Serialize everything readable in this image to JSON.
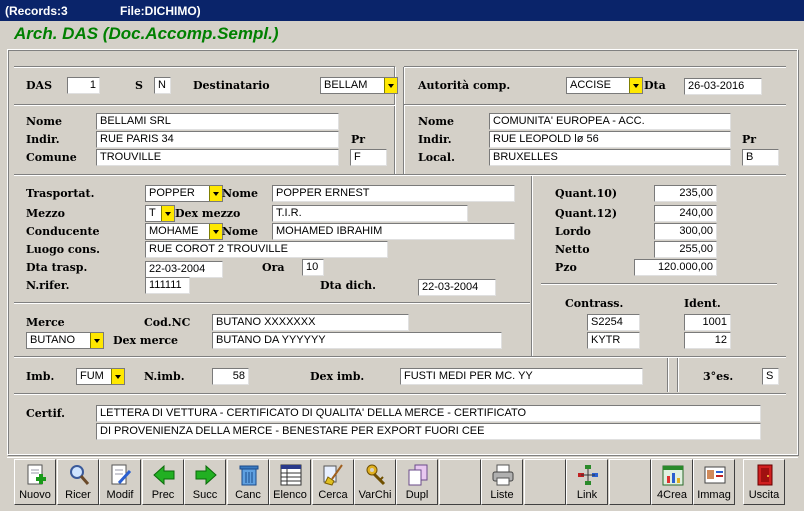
{
  "titlebar": {
    "records": "(Records:3",
    "file": "File:DICHIMO)"
  },
  "app_title": "Arch. DAS (Doc.Accomp.Sempl.)",
  "header": {
    "das_label": "DAS",
    "das_value": "1",
    "s_label": "S",
    "s_value": "N",
    "destinatario_label": "Destinatario",
    "destinatario_value": "BELLAM",
    "autorita_label": "Autorità comp.",
    "autorita_value": "ACCISE",
    "dta_label": "Dta",
    "dta_value": "26-03-2016"
  },
  "dest": {
    "nome_label": "Nome",
    "nome_value": "BELLAMI SRL",
    "indir_label": "Indir.",
    "indir_value": "RUE PARIS 34",
    "comune_label": "Comune",
    "comune_value": "TROUVILLE",
    "pr_label": "Pr",
    "pr_value": "F"
  },
  "auth": {
    "nome_label": "Nome",
    "nome_value": "COMUNITA' EUROPEA - ACC.",
    "indir_label": "Indir.",
    "indir_value": "RUE LEOPOLD lø 56",
    "local_label": "Local.",
    "local_value": "BRUXELLES",
    "pr_label": "Pr",
    "pr_value": "B"
  },
  "transport": {
    "trasportat_label": "Trasportat.",
    "trasportat_value": "POPPER",
    "nome1_label": "Nome",
    "nome1_value": "POPPER ERNEST",
    "mezzo_label": "Mezzo",
    "mezzo_value": "T",
    "dexmezzo_label": "Dex mezzo",
    "dexmezzo_value": "T.I.R.",
    "conducente_label": "Conducente",
    "conducente_value": "MOHAME",
    "nome2_label": "Nome",
    "nome2_value": "MOHAMED IBRAHIM",
    "luogo_label": "Luogo cons.",
    "luogo_value": "RUE COROT 2  TROUVILLE",
    "dtatrasp_label": "Dta trasp.",
    "dtatrasp_value": "22-03-2004",
    "ora_label": "Ora",
    "ora_value": "10",
    "nrifer_label": "N.rifer.",
    "nrifer_value": "111111",
    "dtadich_label": "Dta dich.",
    "dtadich_value": "22-03-2004"
  },
  "quant": {
    "q10_label": "Quant.10)",
    "q10_value": "235,00",
    "q12_label": "Quant.12)",
    "q12_value": "240,00",
    "lordo_label": "Lordo",
    "lordo_value": "300,00",
    "netto_label": "Netto",
    "netto_value": "255,00",
    "pzo_label": "Pzo",
    "pzo_value": "120.000,00"
  },
  "contrass": {
    "contrass_label": "Contrass.",
    "ident_label": "Ident.",
    "c1": "S2254",
    "i1": "1001",
    "c2": "KYTR",
    "i2": "12"
  },
  "merce": {
    "merce_label": "Merce",
    "merce_value": "BUTANO",
    "codnc_label": "Cod.NC",
    "codnc_value": "BUTANO XXXXXXX",
    "dexmerce_label": "Dex merce",
    "dexmerce_value": "BUTANO DA YYYYYY"
  },
  "imb": {
    "imb_label": "Imb.",
    "imb_value": "FUM",
    "nimb_label": "N.imb.",
    "nimb_value": "58",
    "deximb_label": "Dex imb.",
    "deximb_value": "FUSTI MEDI PER MC. YY",
    "es_label": "3°es.",
    "es_value": "S"
  },
  "certif": {
    "label": "Certif.",
    "line1": "LETTERA DI VETTURA - CERTIFICATO DI QUALITA' DELLA MERCE - CERTIFICATO",
    "line2": "DI PROVENIENZA DELLA MERCE - BENESTARE PER EXPORT FUORI CEE"
  },
  "toolbar": {
    "nuovo": "Nuovo",
    "ricer": "Ricer",
    "modif": "Modif",
    "prec": "Prec",
    "succ": "Succ",
    "canc": "Canc",
    "elenco": "Elenco",
    "cerca": "Cerca",
    "varchi": "VarChi",
    "dupl": "Dupl",
    "liste": "Liste",
    "link": "Link",
    "crea4": "4Crea",
    "immag": "Immag",
    "uscita": "Uscita"
  },
  "colors": {
    "title_bar": "#0a246a",
    "app_title": "#008000",
    "dropdown_arrow": "#ffe800"
  }
}
